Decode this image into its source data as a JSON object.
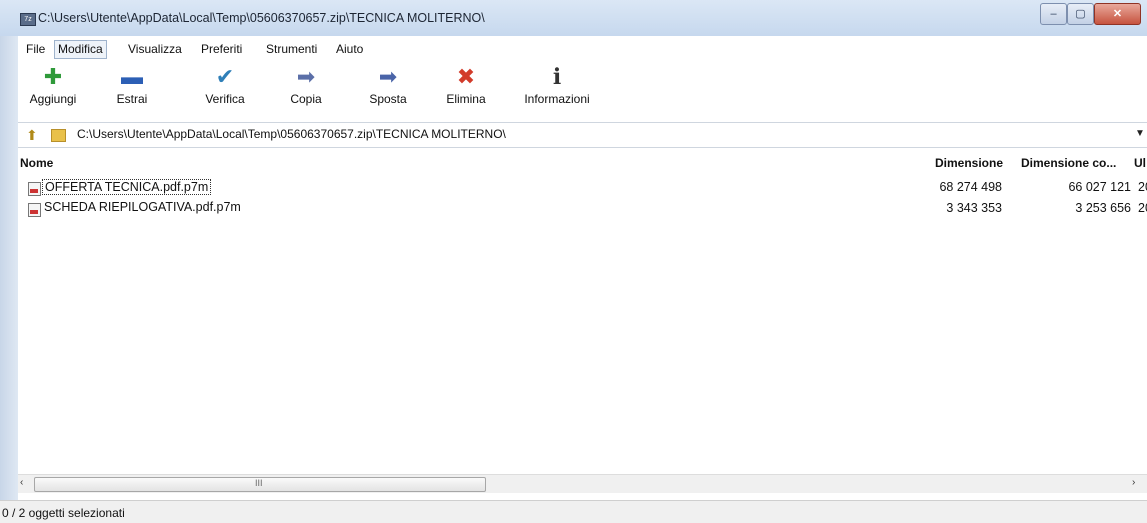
{
  "window": {
    "title": "C:\\Users\\Utente\\AppData\\Local\\Temp\\05606370657.zip\\TECNICA MOLITERNO\\",
    "app_icon_label": "7z",
    "controls": {
      "minimize": "–",
      "maximize": "▢",
      "close": "✕"
    }
  },
  "menu": {
    "items": [
      "File",
      "Modifica",
      "Visualizza",
      "Preferiti",
      "Strumenti",
      "Aiuto"
    ]
  },
  "toolbar": {
    "buttons": [
      {
        "label": "Aggiungi",
        "icon": "plus-icon",
        "glyph": "✚",
        "color": "#2f9a3a"
      },
      {
        "label": "Estrai",
        "icon": "minus-icon",
        "glyph": "▬",
        "color": "#2c5fb5"
      },
      {
        "label": "Verifica",
        "icon": "check-icon",
        "glyph": "✔",
        "color": "#2f7fb8"
      },
      {
        "label": "Copia",
        "icon": "copy-arrow-icon",
        "glyph": "➡",
        "color": "#5b6fa8"
      },
      {
        "label": "Sposta",
        "icon": "move-arrow-icon",
        "glyph": "➡",
        "color": "#4a64a8"
      },
      {
        "label": "Elimina",
        "icon": "delete-x-icon",
        "glyph": "✖",
        "color": "#d23b2a"
      },
      {
        "label": "Informazioni",
        "icon": "info-icon",
        "glyph": "ℹ",
        "color": "#333333"
      }
    ]
  },
  "address": {
    "path": "C:\\Users\\Utente\\AppData\\Local\\Temp\\05606370657.zip\\TECNICA MOLITERNO\\"
  },
  "columns": {
    "name": "Nome",
    "size": "Dimensione",
    "packed": "Dimensione co...",
    "modified": "Ul"
  },
  "files": [
    {
      "name": "OFFERTA TECNICA.pdf.p7m",
      "size": "68 274 498",
      "packed": "66 027 121",
      "modified": "20"
    },
    {
      "name": "SCHEDA RIEPILOGATIVA.pdf.p7m",
      "size": "3 343 353",
      "packed": "3 253 656",
      "modified": "20"
    }
  ],
  "scrollbar": {
    "left": "‹",
    "right": "›",
    "grip": "III"
  },
  "status": {
    "text": "0 / 2 oggetti selezionati"
  }
}
